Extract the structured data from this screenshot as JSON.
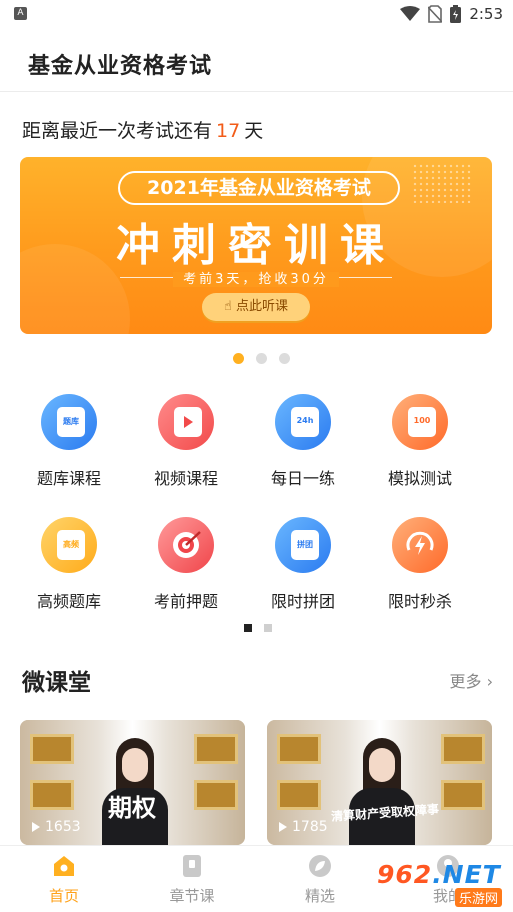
{
  "status_bar": {
    "time": "2:53"
  },
  "app": {
    "title": "基金从业资格考试"
  },
  "countdown": {
    "prefix": "距离最近一次考试还有",
    "days": "17",
    "suffix": "天"
  },
  "banner": {
    "pill": "2021年基金从业资格考试",
    "headline": "冲刺密训课",
    "subline": "考前3天，抢收30分",
    "button": "点此听课",
    "active_index": 0
  },
  "features": {
    "items": [
      {
        "label": "题库课程",
        "icon": "question-bank-icon",
        "badge": "题库"
      },
      {
        "label": "视频课程",
        "icon": "video-play-icon",
        "badge": ""
      },
      {
        "label": "每日一练",
        "icon": "daily-24h-icon",
        "badge": "24h"
      },
      {
        "label": "模拟测试",
        "icon": "score-100-icon",
        "badge": "100"
      },
      {
        "label": "高频题库",
        "icon": "high-frequency-icon",
        "badge": "高频"
      },
      {
        "label": "考前押题",
        "icon": "target-icon",
        "badge": ""
      },
      {
        "label": "限时拼团",
        "icon": "group-buy-icon",
        "badge": "拼团"
      },
      {
        "label": "限时秒杀",
        "icon": "flash-sale-icon",
        "badge": ""
      }
    ]
  },
  "micro_class": {
    "title": "微课堂",
    "more": "更多",
    "cards": [
      {
        "caption": "期权",
        "plays": "1653"
      },
      {
        "caption": "清算财产受取权障事",
        "plays": "1785"
      }
    ]
  },
  "bottom_nav": {
    "tabs": [
      {
        "label": "首页",
        "icon": "home-icon",
        "active": true
      },
      {
        "label": "章节课",
        "icon": "book-icon",
        "active": false
      },
      {
        "label": "精选",
        "icon": "leaf-icon",
        "active": false
      },
      {
        "label": "我的",
        "icon": "profile-icon",
        "active": false
      }
    ]
  },
  "watermark": {
    "main_a": "962",
    "main_b": ".NET",
    "sub": "乐游网"
  },
  "colors": {
    "accent": "#ffa21a",
    "countdown_days": "#f25c19"
  }
}
